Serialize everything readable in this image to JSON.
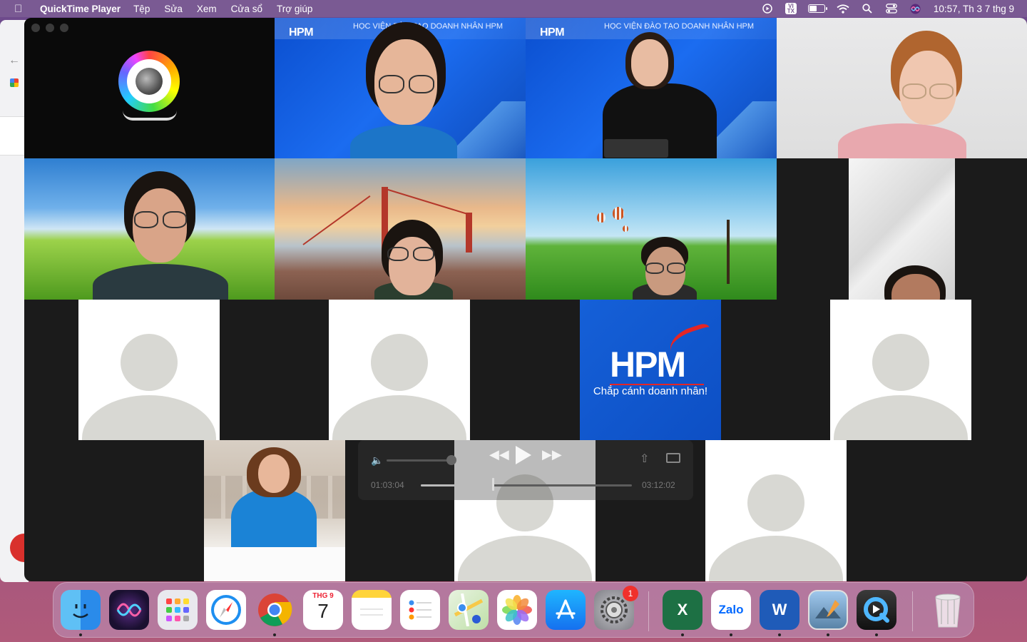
{
  "menubar": {
    "app_name": "QuickTime Player",
    "menus": [
      "Tệp",
      "Sửa",
      "Xem",
      "Cửa sổ",
      "Trợ giúp"
    ],
    "input_method": "VI TX",
    "clock": "10:57, Th 3 7 thg 9"
  },
  "tiles": {
    "banner_left": "HỌC VIỆN ĐÀO TẠO DOANH NHÂN HPM",
    "banner_right": "HỌC VIỆN ĐÀO TẠO DOANH NHÂN HPM",
    "logo_small": "HPM",
    "logo_small_2": "HPM",
    "hpm_logo": "HPM",
    "hpm_tagline": "Chắp cánh doanh nhân!"
  },
  "player_controls": {
    "elapsed": "01:03:04",
    "remaining": "03:12:02",
    "progress_fraction": 0.34
  },
  "dock": {
    "apps": [
      {
        "name": "Finder"
      },
      {
        "name": "Siri"
      },
      {
        "name": "Launchpad"
      },
      {
        "name": "Safari"
      },
      {
        "name": "Chrome"
      },
      {
        "name": "Calendar"
      },
      {
        "name": "Notes"
      },
      {
        "name": "Reminders"
      },
      {
        "name": "Maps"
      },
      {
        "name": "Photos"
      },
      {
        "name": "App Store"
      },
      {
        "name": "System Preferences"
      },
      {
        "name": "Excel"
      },
      {
        "name": "Zalo"
      },
      {
        "name": "Word"
      },
      {
        "name": "Preview"
      },
      {
        "name": "QuickTime Player"
      },
      {
        "name": "Trash"
      }
    ],
    "calendar_month": "THG 9",
    "calendar_day": "7",
    "settings_badge": "1",
    "excel_letter": "X",
    "zalo_label": "Zalo",
    "word_letter": "W"
  },
  "colors": {
    "menubar": "#7a5a93",
    "hpm_blue": "#1560d8",
    "hpm_red": "#e52525"
  }
}
